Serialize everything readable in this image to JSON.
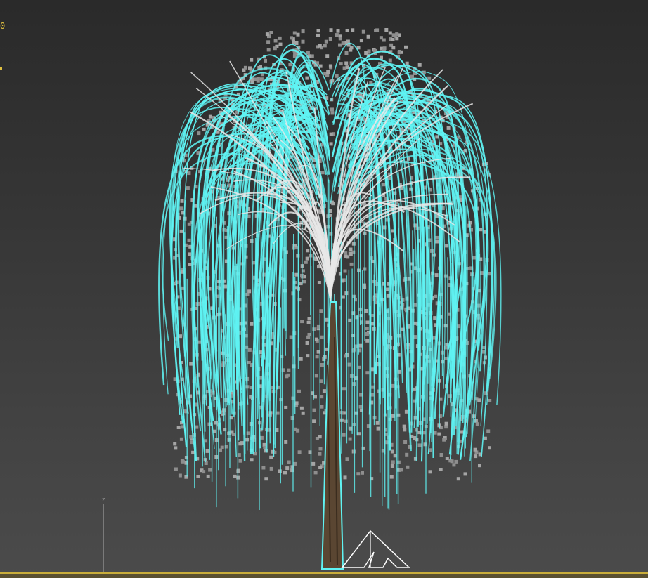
{
  "viewport": {
    "stats_text": "0",
    "axis_label": "z",
    "colors": {
      "background_top": "#2a2a2a",
      "background_bottom": "#4b4b4b",
      "selection_cyan": "#5ff3f3",
      "branch_white": "#e8e8e8",
      "trunk_brown": "#5a4632",
      "ground_line": "#c9ad3a",
      "stats_text": "#e0c040"
    },
    "objects": {
      "tree": "weeping-willow",
      "gizmo": "pivot-gizmo-icon"
    }
  }
}
